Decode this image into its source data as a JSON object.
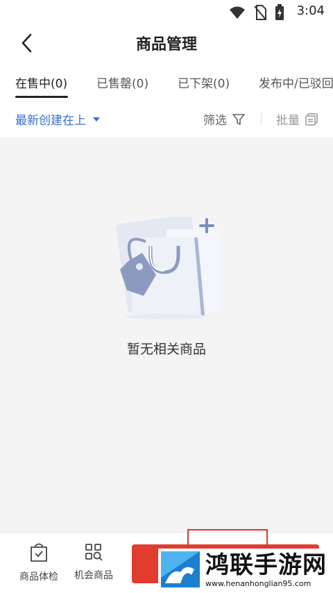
{
  "status_bar": {
    "time": "3:04"
  },
  "header": {
    "title": "商品管理"
  },
  "tabs": [
    {
      "label": "在售中(0)",
      "active": true
    },
    {
      "label": "已售罄(0)",
      "active": false
    },
    {
      "label": "已下架(0)",
      "active": false
    },
    {
      "label": "发布中/已驳回",
      "active": false
    }
  ],
  "filter_bar": {
    "sort_label": "最新创建在上",
    "filter_label": "筛选",
    "batch_label": "批量"
  },
  "empty_state": {
    "text": "暂无相关商品"
  },
  "bottom_bar": {
    "items": [
      {
        "label": "商品体检"
      },
      {
        "label": "机会商品"
      }
    ]
  },
  "watermark": {
    "title": "鸿联手游网",
    "url": "www.henanhonglian95.com"
  },
  "colors": {
    "accent": "#3a6fce",
    "publish_button": "#e13c2e",
    "background": "#f4f4f4"
  }
}
